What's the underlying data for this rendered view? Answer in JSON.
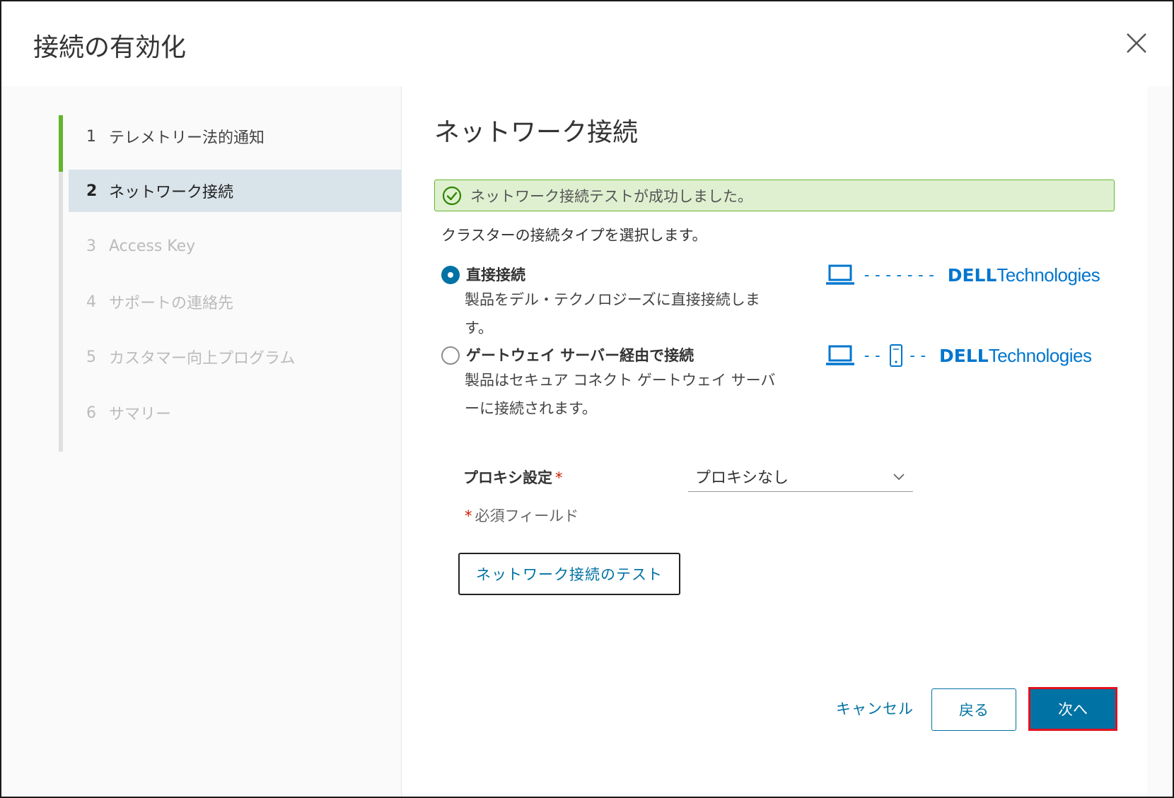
{
  "dialog": {
    "title": "接続の有効化"
  },
  "steps": [
    {
      "num": "1",
      "label": "テレメトリー法的通知",
      "state": "completed"
    },
    {
      "num": "2",
      "label": "ネットワーク接続",
      "state": "active"
    },
    {
      "num": "3",
      "label": "Access Key",
      "state": "disabled"
    },
    {
      "num": "4",
      "label": "サポートの連絡先",
      "state": "disabled"
    },
    {
      "num": "5",
      "label": "カスタマー向上プログラム",
      "state": "disabled"
    },
    {
      "num": "6",
      "label": "サマリー",
      "state": "disabled"
    }
  ],
  "main": {
    "title": "ネットワーク接続",
    "alert_text": "ネットワーク接続テストが成功しました。",
    "prompt": "クラスターの接続タイプを選択します。",
    "options": [
      {
        "label": "直接接続",
        "desc": "製品をデル・テクノロジーズに直接接続します。",
        "checked": true,
        "diagram_dashes": "-------"
      },
      {
        "label": "ゲートウェイ サーバー経由で接続",
        "desc": "製品はセキュア コネクト ゲートウェイ サーバーに接続されます。",
        "checked": false,
        "diagram_dashes_left": "--",
        "diagram_dashes_right": "--"
      }
    ],
    "logo": {
      "dell": "DELL",
      "tech": "Technologies"
    },
    "proxy": {
      "label": "プロキシ設定",
      "required_mark": "*",
      "selected": "プロキシなし"
    },
    "required_note_mark": "*",
    "required_note": "必須フィールド",
    "test_button": "ネットワーク接続のテスト"
  },
  "footer": {
    "cancel": "キャンセル",
    "back": "戻る",
    "next": "次へ"
  },
  "colors": {
    "accent": "#0072a3",
    "success": "#62b52c",
    "dell_blue": "#0076ce",
    "highlight_border": "#e3101e"
  }
}
